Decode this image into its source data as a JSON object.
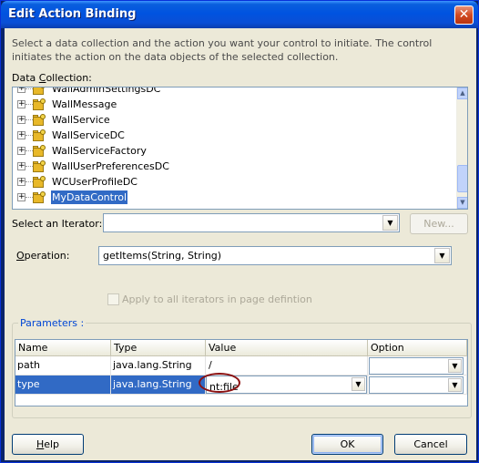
{
  "window": {
    "title": "Edit Action Binding",
    "close_glyph": "✕"
  },
  "description": "Select a data collection and the action you want your control to initiate. The control initiates the action on the data objects of the selected collection.",
  "data_collection": {
    "label_pre": "Data ",
    "label_u": "C",
    "label_post": "ollection:",
    "items": [
      {
        "label": "WallAdminSettingsDC",
        "selected": false
      },
      {
        "label": "WallMessage",
        "selected": false
      },
      {
        "label": "WallService",
        "selected": false
      },
      {
        "label": "WallServiceDC",
        "selected": false
      },
      {
        "label": "WallServiceFactory",
        "selected": false
      },
      {
        "label": "WallUserPreferencesDC",
        "selected": false
      },
      {
        "label": "WCUserProfileDC",
        "selected": false
      },
      {
        "label": "MyDataControl",
        "selected": true
      }
    ],
    "expander_glyph": "+"
  },
  "iterator": {
    "label": "Select an Iterator:",
    "value": "",
    "new_button": "New..."
  },
  "operation": {
    "label_u": "O",
    "label_post": "peration:",
    "value": "getItems(String, String)"
  },
  "apply_all": {
    "label": "Apply to all iterators in page defintion",
    "checked": false
  },
  "parameters": {
    "title": "Parameters :",
    "columns": [
      "Name",
      "Type",
      "Value",
      "Option"
    ],
    "rows": [
      {
        "name": "path",
        "type": "java.lang.String",
        "value": "/",
        "option": ""
      },
      {
        "name": "type",
        "type": "java.lang.String",
        "value": "nt:file",
        "option": ""
      }
    ]
  },
  "buttons": {
    "help_u": "H",
    "help_post": "elp",
    "ok": "OK",
    "cancel": "Cancel"
  },
  "icons": {
    "dropdown": "▼",
    "scroll_up": "▲",
    "scroll_down": "▼"
  },
  "colors": {
    "selection": "#316ac5",
    "annotation": "#8b1010",
    "title_bar": "#0053e0"
  }
}
